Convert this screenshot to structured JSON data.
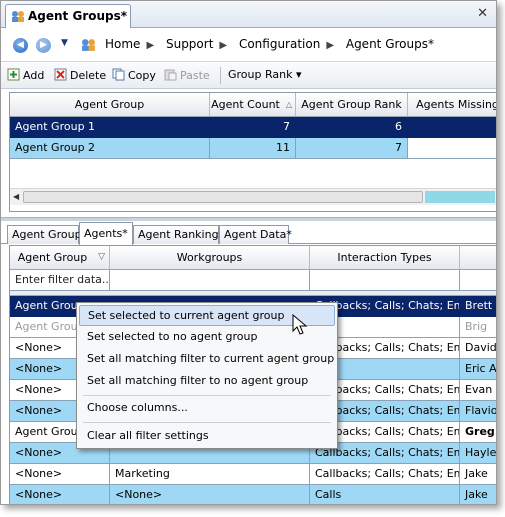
{
  "doc_tab": {
    "title": "Agent Groups*",
    "close": "✕"
  },
  "breadcrumb": {
    "items": [
      "Home",
      "Support",
      "Configuration",
      "Agent Groups*"
    ],
    "separator": "▶"
  },
  "toolbar": {
    "add": "Add",
    "delete": "Delete",
    "copy": "Copy",
    "paste": "Paste",
    "group_rank": "Group Rank ▾"
  },
  "top_grid": {
    "columns": [
      "Agent Group",
      "Agent Count",
      "Agent Group Rank",
      "Agents Missing"
    ],
    "rows": [
      {
        "name": "Agent Group 1",
        "count": "7",
        "rank": "6"
      },
      {
        "name": "Agent Group 2",
        "count": "11",
        "rank": "7"
      }
    ]
  },
  "tabs": [
    "Agent Group",
    "Agents*",
    "Agent Rankings",
    "Agent Data*"
  ],
  "bottom_grid": {
    "columns": [
      "Agent Group",
      "Workgroups",
      "Interaction Types",
      ""
    ],
    "filter_placeholder": "Enter filter data...",
    "rows": [
      {
        "group": "Agent Group",
        "workgroup": "",
        "itypes": "Callbacks; Calls; Chats; Em",
        "agent": "Brett"
      },
      {
        "group": "Agent Group",
        "workgroup": "",
        "itypes": "",
        "agent": "Brig"
      },
      {
        "group": "<None>",
        "workgroup": "",
        "itypes": "Callbacks; Calls; Chats; Em",
        "agent": "David"
      },
      {
        "group": "<None>",
        "workgroup": "",
        "itypes": "",
        "agent": "Eric A"
      },
      {
        "group": "<None>",
        "workgroup": "",
        "itypes": "Callbacks; Calls; Chats; Em",
        "agent": "Evan"
      },
      {
        "group": "<None>",
        "workgroup": "",
        "itypes": "Callbacks; Calls; Chats; Em",
        "agent": "Flavio"
      },
      {
        "group": "Agent Group",
        "workgroup": "",
        "itypes": "Callbacks; Calls; Chats; Em",
        "agent": "Greg"
      },
      {
        "group": "<None>",
        "workgroup": "",
        "itypes": "Callbacks; Calls; Chats; Em",
        "agent": "Hayley"
      },
      {
        "group": "<None>",
        "workgroup": "Marketing",
        "itypes": "Callbacks; Calls; Chats; Em",
        "agent": "Jake"
      },
      {
        "group": "<None>",
        "workgroup": "<None>",
        "itypes": "Calls",
        "agent": "Jake"
      }
    ]
  },
  "context_menu": {
    "items": [
      "Set selected to current agent group",
      "Set selected to no agent group",
      "Set all matching filter to current agent group",
      "Set all matching filter to no agent group",
      "Choose columns...",
      "Clear all filter settings"
    ]
  },
  "colors": {
    "selected_row": "#0a246a",
    "alt_row": "#9fd8f5",
    "menu_highlight": "#d7e5f7"
  }
}
